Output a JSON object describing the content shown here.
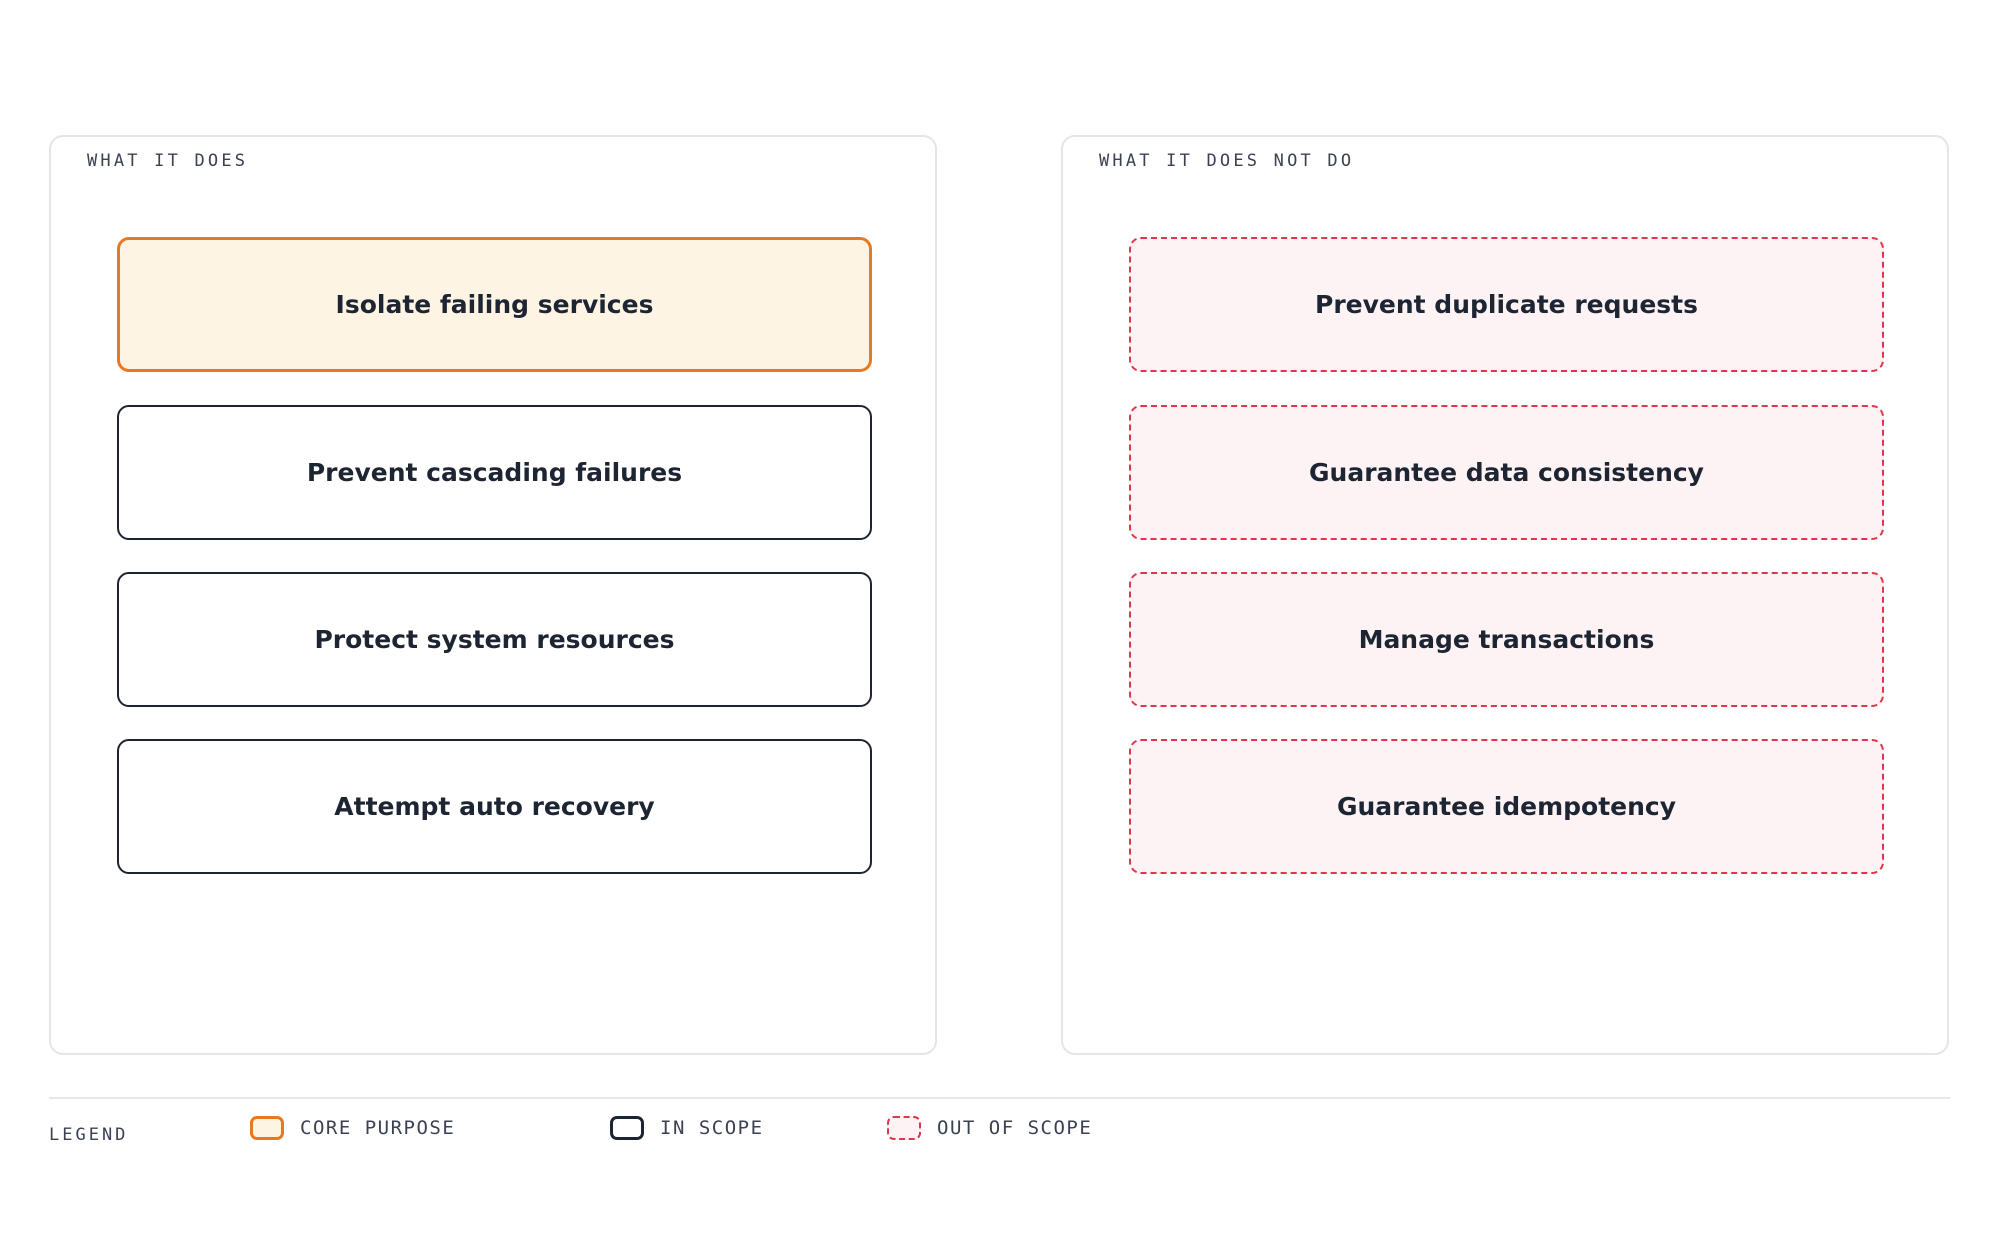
{
  "panels": {
    "does": {
      "label": "WHAT IT DOES",
      "items": [
        {
          "text": "Isolate failing services",
          "kind": "core"
        },
        {
          "text": "Prevent cascading failures",
          "kind": "in-scope"
        },
        {
          "text": "Protect system resources",
          "kind": "in-scope"
        },
        {
          "text": "Attempt auto recovery",
          "kind": "in-scope"
        }
      ]
    },
    "does_not": {
      "label": "WHAT IT DOES NOT DO",
      "items": [
        {
          "text": "Prevent duplicate requests",
          "kind": "out-of-scope"
        },
        {
          "text": "Guarantee data consistency",
          "kind": "out-of-scope"
        },
        {
          "text": "Manage transactions",
          "kind": "out-of-scope"
        },
        {
          "text": "Guarantee idempotency",
          "kind": "out-of-scope"
        }
      ]
    }
  },
  "legend": {
    "title": "LEGEND",
    "core": "CORE PURPOSE",
    "in_scope": "IN SCOPE",
    "out_of_scope": "OUT OF SCOPE"
  },
  "colors": {
    "core_border": "#e8791f",
    "core_fill": "#fef4e4",
    "in_scope_border": "#1d2533",
    "out_of_scope_border": "#e0354c",
    "out_of_scope_fill": "#fdf3f4"
  }
}
